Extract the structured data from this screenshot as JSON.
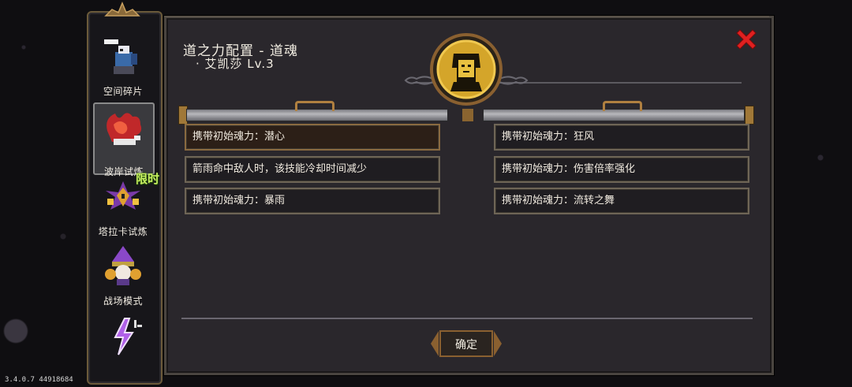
{
  "sidebar": {
    "items": [
      {
        "label": "空间碎片",
        "icon": "space-fragment-icon"
      },
      {
        "label": "波岸试炼",
        "icon": "wave-trial-icon",
        "active": true
      },
      {
        "label": "塔拉卡试炼",
        "icon": "taraka-trial-icon",
        "badge": "限时"
      },
      {
        "label": "战场模式",
        "icon": "battlefield-icon"
      },
      {
        "label": "",
        "icon": "lightning-icon"
      }
    ]
  },
  "dialog": {
    "title_line1": "道之力配置 - 道魂",
    "title_line2": "· 艾凯莎 Lv.3",
    "confirm_label": "确定"
  },
  "left_column": [
    "携带初始魂力：潜心",
    "箭雨命中敌人时，该技能冷却时间减少",
    "携带初始魂力：暴雨"
  ],
  "right_column": [
    "携带初始魂力：狂风",
    "携带初始魂力：伤害倍率强化",
    "携带初始魂力：流转之舞"
  ],
  "version": "3.4.0.7 44918684",
  "colors": {
    "panel_bg": "#2a272c",
    "row_border": "#6e6556",
    "highlight_bg": "#2c1f17",
    "close_red": "#e02020",
    "gold": "#d4a52a"
  }
}
